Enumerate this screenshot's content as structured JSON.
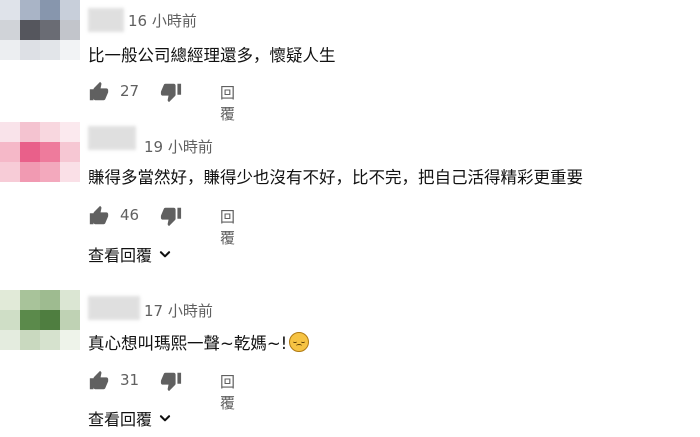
{
  "comments": [
    {
      "time": "16 小時前",
      "text": "比一般公司總經理還多，懷疑人生",
      "likes": "27",
      "reply_label": "回覆"
    },
    {
      "time": "19 小時前",
      "text": "賺得多當然好，賺得少也沒有不好，比不完，把自己活得精彩更重要",
      "likes": "46",
      "reply_label": "回覆",
      "view_replies": "查看回覆"
    },
    {
      "time": "17 小時前",
      "text": "真心想叫瑪熙一聲~乾媽~!",
      "likes": "31",
      "reply_label": "回覆",
      "view_replies": "查看回覆"
    }
  ],
  "icons": {
    "like": "thumbs-up-icon",
    "dislike": "thumbs-down-icon",
    "expand": "chevron-down-icon",
    "emoji": "pleading-face-emoji"
  },
  "colors": {
    "text": "#0f0f0f",
    "meta": "#606060",
    "icon": "#606060"
  }
}
